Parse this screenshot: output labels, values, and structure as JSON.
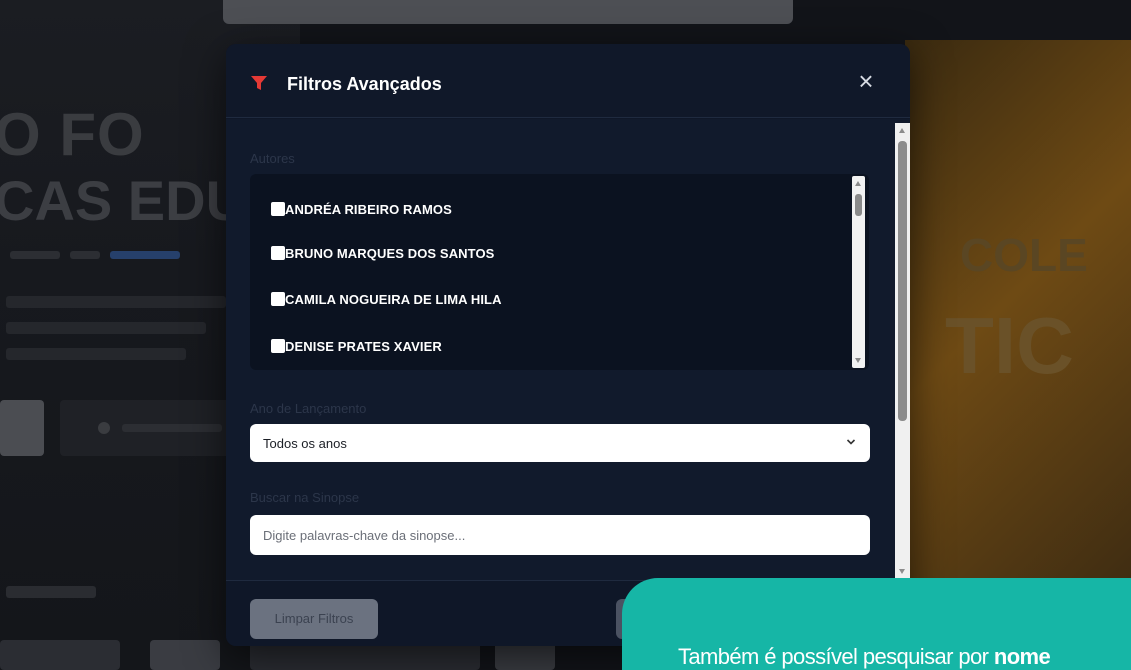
{
  "modal": {
    "title": "Filtros Avançados",
    "close_label": "×",
    "authors_label": "Autores",
    "authors": [
      "ANDRÉA RIBEIRO RAMOS",
      "BRUNO MARQUES DOS SANTOS",
      "CAMILA NOGUEIRA DE LIMA HILA",
      "DENISE PRATES XAVIER"
    ],
    "year_label": "Ano de Lançamento",
    "year_selected": "Todos os anos",
    "synopsis_label": "Buscar na Sinopse",
    "synopsis_placeholder": "Digite palavras-chave da sinopse...",
    "clear_button": "Limpar Filtros"
  },
  "tooltip": {
    "text_before": "Também é possível pesquisar por ",
    "text_bold": "nome"
  },
  "colors": {
    "modal_bg": "#0f1728",
    "accent_red": "#e53935",
    "tooltip_teal": "#16b6a6"
  },
  "icons": {
    "filter": "funnel-icon",
    "close": "close-icon",
    "select": "chevron-down-icon"
  }
}
